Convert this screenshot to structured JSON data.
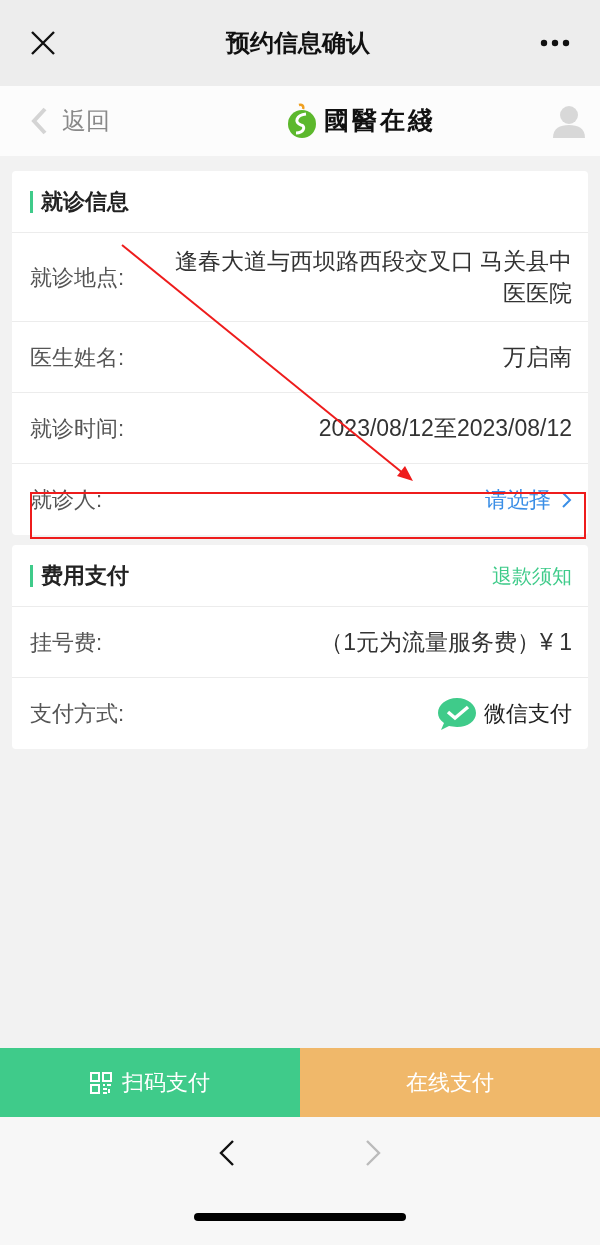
{
  "top_bar": {
    "title": "预约信息确认"
  },
  "header": {
    "back_label": "返回",
    "logo_text": "國醫在綫"
  },
  "sections": [
    {
      "title": "就诊信息",
      "rows": [
        {
          "kind": "text",
          "label": "就诊地点:",
          "value": "逢春大道与西坝路西段交叉口 马关县中医医院"
        },
        {
          "kind": "text",
          "label": "医生姓名:",
          "value": "万启南"
        },
        {
          "kind": "text",
          "label": "就诊时间:",
          "value": "2023/08/12至2023/08/12"
        },
        {
          "kind": "link",
          "label": "就诊人:",
          "value": "请选择"
        }
      ]
    },
    {
      "title": "费用支付",
      "action": "退款须知",
      "rows": [
        {
          "kind": "text",
          "label": "挂号费:",
          "value": "（1元为流量服务费）¥ 1"
        },
        {
          "kind": "payment",
          "label": "支付方式:",
          "value": "微信支付"
        }
      ]
    }
  ],
  "buttons": [
    {
      "kind": "scan",
      "label": "扫码支付"
    },
    {
      "kind": "online",
      "label": "在线支付"
    }
  ],
  "browser_nav": {
    "back_disabled": false,
    "forward_disabled": true
  }
}
